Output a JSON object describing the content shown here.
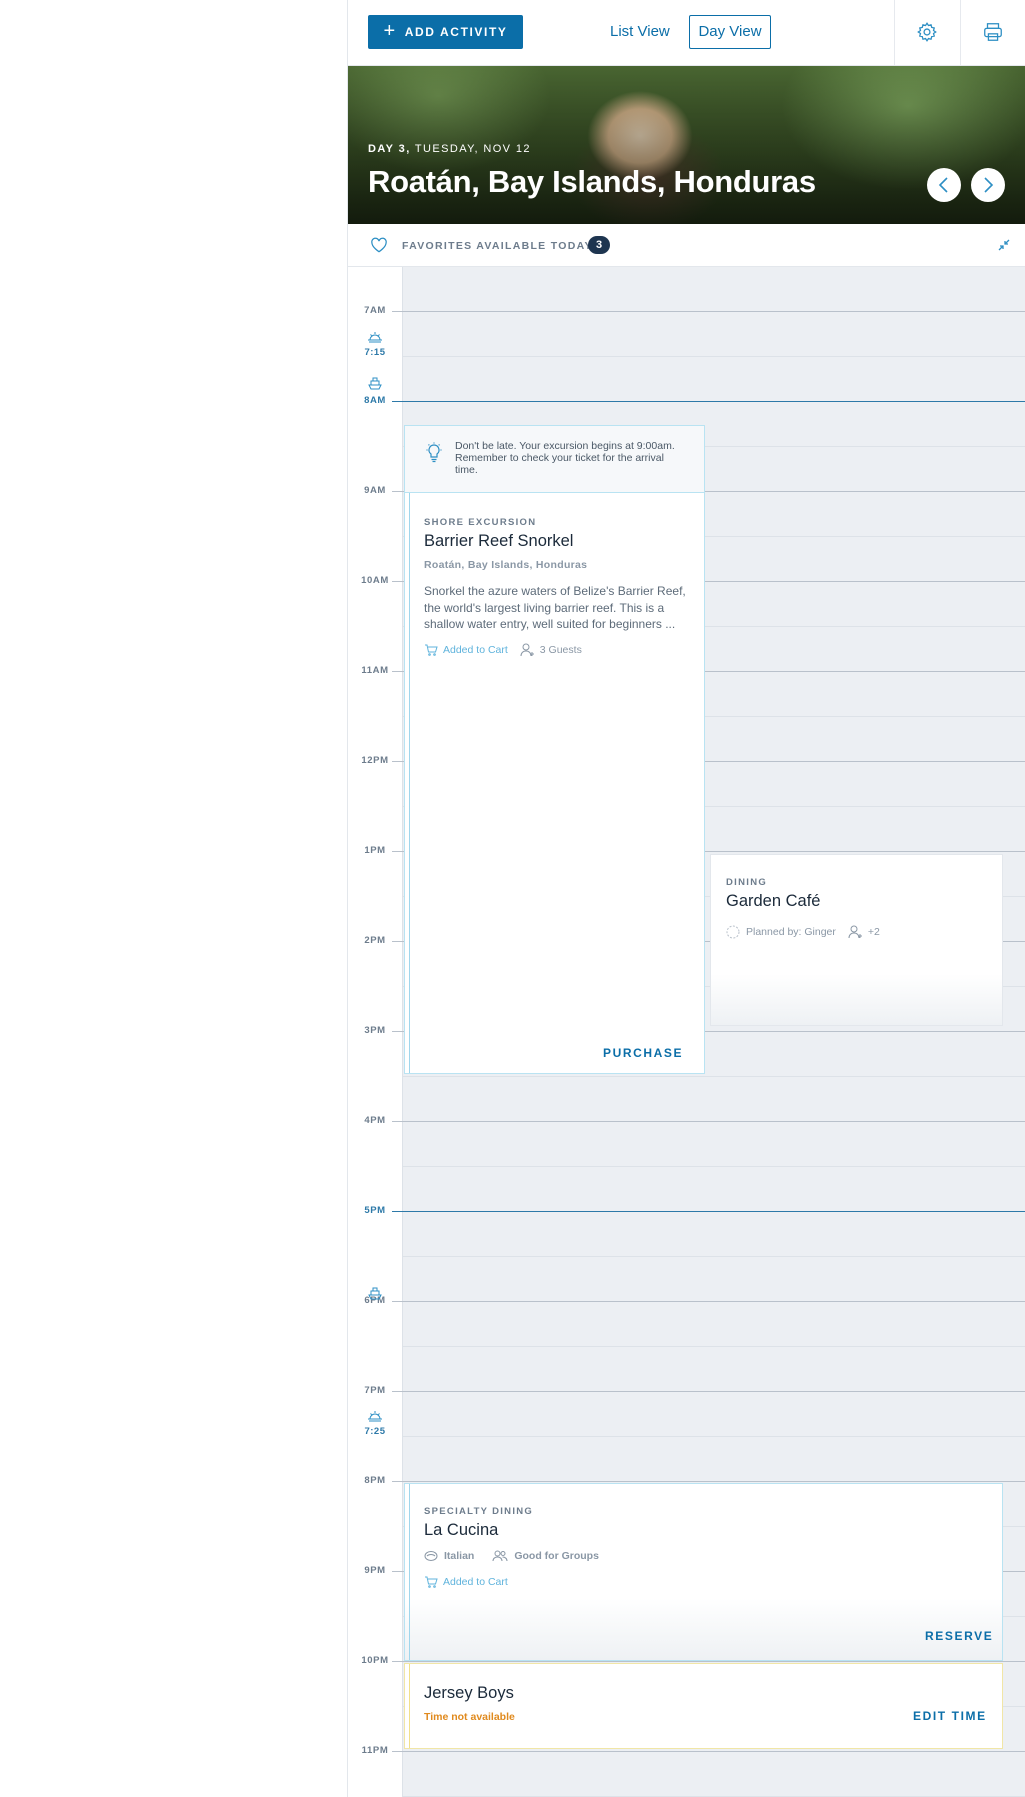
{
  "toolbar": {
    "add_activity_label": "ADD ACTIVITY",
    "list_view_label": "List View",
    "day_view_label": "Day View"
  },
  "hero": {
    "day_number": "DAY 3,",
    "date": "TUESDAY, NOV 12",
    "location": "Roatán, Bay Islands, Honduras"
  },
  "favorites": {
    "label": "FAVORITES AVAILABLE TODAY",
    "count": "3"
  },
  "timeline": {
    "hours": [
      "7AM",
      "8AM",
      "9AM",
      "10AM",
      "11AM",
      "12PM",
      "1PM",
      "2PM",
      "3PM",
      "4PM",
      "5PM",
      "6PM",
      "7PM",
      "8PM",
      "9PM",
      "10PM",
      "11PM"
    ],
    "sunrise_time": "7:15",
    "sunset_time": "7:25"
  },
  "tip": {
    "text": "Don't be late. Your excursion begins at 9:00am. Remember to check your ticket for the arrival time."
  },
  "activities": {
    "snorkel": {
      "category": "SHORE EXCURSION",
      "title": "Barrier Reef Snorkel",
      "location": "Roatán, Bay Islands, Honduras",
      "description": "Snorkel the azure waters of Belize's Barrier Reef, the world's largest living barrier reef. This is a shallow water entry, well suited for beginners ...",
      "cart_status": "Added to Cart",
      "guests": "3 Guests",
      "action": "PURCHASE"
    },
    "garden": {
      "category": "DINING",
      "title": "Garden Café",
      "planned_by": "Planned by: Ginger",
      "extra_guests": "+2"
    },
    "cucina": {
      "category": "SPECIALTY DINING",
      "title": "La Cucina",
      "cuisine": "Italian",
      "group_tag": "Good for Groups",
      "cart_status": "Added to Cart",
      "action": "RESERVE"
    },
    "jersey": {
      "title": "Jersey Boys",
      "warning": "Time not available",
      "action": "EDIT TIME"
    }
  },
  "colors": {
    "brand": "#0b6ea8",
    "navy": "#1e3550",
    "warning": "#e08a1e",
    "grid_bg": "#eceff3"
  }
}
